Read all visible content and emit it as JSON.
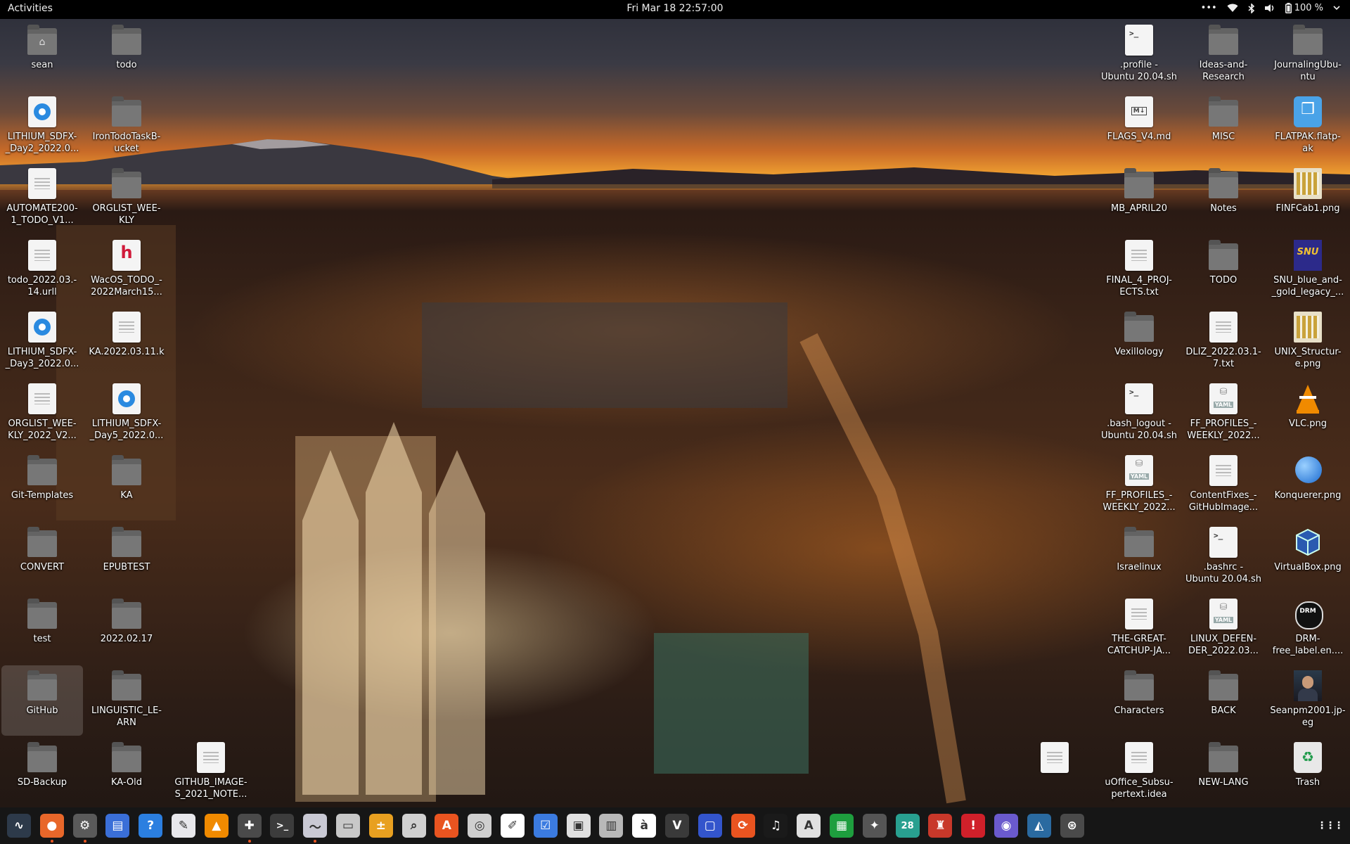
{
  "topbar": {
    "activities": "Activities",
    "clock": "Fri Mar 18  22:57:00",
    "overflow": "•••",
    "battery": "100 %"
  },
  "desktop": [
    {
      "label": "sean",
      "icon": "home-folder-icon",
      "type": "home"
    },
    {
      "label": "todo",
      "icon": "folder-icon",
      "type": "folder"
    },
    {
      "label": ".profile -\nUbuntu 20.04.sh",
      "icon": "terminal-script-icon",
      "type": "script"
    },
    {
      "label": "Ideas-and-\nResearch",
      "icon": "folder-icon",
      "type": "folder"
    },
    {
      "label": "JournalingUbu-\nntu",
      "icon": "folder-icon",
      "type": "folder"
    },
    {
      "label": "LITHIUM_SDFX-\n_Day2_2022.0...",
      "icon": "lithium-doc-icon",
      "type": "lithium"
    },
    {
      "label": "IronTodoTaskB-\nucket",
      "icon": "folder-icon",
      "type": "folder"
    },
    {
      "label": "FLAGS_V4.md",
      "icon": "markdown-icon",
      "type": "md"
    },
    {
      "label": "MISC",
      "icon": "folder-icon",
      "type": "folder"
    },
    {
      "label": "FLATPAK.flatp-\nak",
      "icon": "flatpak-icon",
      "type": "flatpak"
    },
    {
      "label": "AUTOMATE200-\n1_TODO_V1...",
      "icon": "text-file-icon",
      "type": "doc"
    },
    {
      "label": "ORGLIST_WEE-\nKLY",
      "icon": "folder-icon",
      "type": "folder"
    },
    {
      "label": "MB_APRIL20",
      "icon": "folder-icon",
      "type": "folder"
    },
    {
      "label": "Notes",
      "icon": "folder-icon",
      "type": "folder"
    },
    {
      "label": "FINFCab1.png",
      "icon": "image-icon",
      "type": "img"
    },
    {
      "label": "todo_2022.03.-\n14.urll",
      "icon": "text-file-icon",
      "type": "doc"
    },
    {
      "label": "WacOS_TODO_-\n2022March15...",
      "icon": "hackmd-icon",
      "type": "hmd"
    },
    {
      "label": "FINAL_4_PROJ-\nECTS.txt",
      "icon": "text-file-icon",
      "type": "doc"
    },
    {
      "label": "TODO",
      "icon": "folder-icon",
      "type": "folder"
    },
    {
      "label": "SNU_blue_and-\n_gold_legacy_...",
      "icon": "snu-image-icon",
      "type": "snu"
    },
    {
      "label": "LITHIUM_SDFX-\n_Day3_2022.0...",
      "icon": "lithium-doc-icon",
      "type": "lithium"
    },
    {
      "label": "KA.2022.03.11.k",
      "icon": "text-file-icon",
      "type": "doc"
    },
    {
      "label": "Vexillology",
      "icon": "folder-icon",
      "type": "folder"
    },
    {
      "label": "DLIZ_2022.03.1-\n7.txt",
      "icon": "text-file-icon",
      "type": "doc"
    },
    {
      "label": "UNIX_Structur-\ne.png",
      "icon": "image-icon",
      "type": "img"
    },
    {
      "label": "ORGLIST_WEE-\nKLY_2022_V2...",
      "icon": "text-file-icon",
      "type": "doc"
    },
    {
      "label": "LITHIUM_SDFX-\n_Day5_2022.0...",
      "icon": "lithium-doc-icon",
      "type": "lithium"
    },
    {
      "label": ".bash_logout -\nUbuntu 20.04.sh",
      "icon": "terminal-script-icon",
      "type": "script"
    },
    {
      "label": "FF_PROFILES_-\nWEEKLY_2022...",
      "icon": "yaml-icon",
      "type": "yaml"
    },
    {
      "label": "VLC.png",
      "icon": "vlc-icon",
      "type": "vlc"
    },
    {
      "label": "Git-Templates",
      "icon": "folder-icon",
      "type": "folder"
    },
    {
      "label": "KA",
      "icon": "folder-icon",
      "type": "folder"
    },
    {
      "label": "FF_PROFILES_-\nWEEKLY_2022...",
      "icon": "yaml-icon",
      "type": "yaml"
    },
    {
      "label": "ContentFixes_-\nGitHubImage...",
      "icon": "text-file-icon",
      "type": "doc"
    },
    {
      "label": "Konquerer.png",
      "icon": "konqueror-icon",
      "type": "globe"
    },
    {
      "label": "CONVERT",
      "icon": "folder-icon",
      "type": "folder"
    },
    {
      "label": "EPUBTEST",
      "icon": "folder-icon",
      "type": "folder"
    },
    {
      "label": "Israelinux",
      "icon": "folder-icon",
      "type": "folder"
    },
    {
      "label": ".bashrc -\nUbuntu 20.04.sh",
      "icon": "terminal-script-icon",
      "type": "script"
    },
    {
      "label": "VirtualBox.png",
      "icon": "virtualbox-icon",
      "type": "vbox"
    },
    {
      "label": "test",
      "icon": "folder-icon",
      "type": "folder"
    },
    {
      "label": "2022.02.17",
      "icon": "folder-icon",
      "type": "folder"
    },
    {
      "label": "THE-GREAT-\nCATCHUP-JA...",
      "icon": "text-file-icon",
      "type": "doc"
    },
    {
      "label": "LINUX_DEFEN-\nDER_2022.03...",
      "icon": "yaml-icon",
      "type": "yaml"
    },
    {
      "label": "DRM-\nfree_label.en....",
      "icon": "drm-free-icon",
      "type": "drm"
    },
    {
      "label": "GitHub",
      "icon": "folder-icon",
      "type": "folder"
    },
    {
      "label": "LINGUISTIC_LE-\nARN",
      "icon": "folder-icon",
      "type": "folder"
    },
    {
      "label": "Characters",
      "icon": "folder-icon",
      "type": "folder"
    },
    {
      "label": "BACK",
      "icon": "folder-icon",
      "type": "folder"
    },
    {
      "label": "Seanpm2001.jp-\neg",
      "icon": "photo-icon",
      "type": "photo"
    },
    {
      "label": "SD-Backup",
      "icon": "folder-icon",
      "type": "folder"
    },
    {
      "label": "KA-Old",
      "icon": "folder-icon",
      "type": "folder"
    },
    {
      "label": "GITHUB_IMAGE-\nS_2021_NOTE...",
      "icon": "text-file-icon",
      "type": "doc"
    },
    {
      "label": "",
      "icon": "text-file-icon",
      "type": "doc"
    },
    {
      "label": "uOffice_Subsu-\npertext.idea",
      "icon": "text-file-icon",
      "type": "doc"
    },
    {
      "label": "NEW-LANG",
      "icon": "folder-icon",
      "type": "folder"
    },
    {
      "label": "Trash",
      "icon": "trash-icon",
      "type": "trash"
    }
  ],
  "dock": [
    {
      "name": "system-monitor-icon",
      "glyph": "∿",
      "bg": "#2d3a4a",
      "running": false
    },
    {
      "name": "firefox-icon",
      "glyph": "●",
      "bg": "#e8672a",
      "running": true
    },
    {
      "name": "settings-icon",
      "glyph": "⚙",
      "bg": "#5a5a5a",
      "running": true
    },
    {
      "name": "document-viewer-icon",
      "glyph": "▤",
      "bg": "#3a6fd8",
      "running": false
    },
    {
      "name": "help-icon",
      "glyph": "?",
      "bg": "#2b7fe0",
      "running": false
    },
    {
      "name": "text-editor-icon",
      "glyph": "✎",
      "bg": "#e8e8ec",
      "running": false
    },
    {
      "name": "vlc-icon",
      "glyph": "▲",
      "bg": "#f08a00",
      "running": false
    },
    {
      "name": "extensions-icon",
      "glyph": "✚",
      "bg": "#4a4a4a",
      "running": true
    },
    {
      "name": "terminal-icon",
      "glyph": ">_",
      "bg": "#3c3c3c",
      "running": false
    },
    {
      "name": "resource-monitor-icon",
      "glyph": "〜",
      "bg": "#c9c9d4",
      "running": true
    },
    {
      "name": "files-icon",
      "glyph": "▭",
      "bg": "#c8c8c8",
      "running": false
    },
    {
      "name": "calculator-icon",
      "glyph": "±",
      "bg": "#e8a020",
      "running": false
    },
    {
      "name": "image-viewer-icon",
      "glyph": "⌕",
      "bg": "#d0d0d0",
      "running": false
    },
    {
      "name": "software-center-icon",
      "glyph": "A",
      "bg": "#e95420",
      "running": false
    },
    {
      "name": "disc-icon",
      "glyph": "◎",
      "bg": "#cfcfcf",
      "running": false
    },
    {
      "name": "libreoffice-draw-icon",
      "glyph": "✐",
      "bg": "#ffffff",
      "running": false
    },
    {
      "name": "todo-icon",
      "glyph": "☑",
      "bg": "#3b7be0",
      "running": false
    },
    {
      "name": "screenshot-icon",
      "glyph": "▣",
      "bg": "#e0e0e0",
      "running": false
    },
    {
      "name": "archive-icon",
      "glyph": "▥",
      "bg": "#b8b8b8",
      "running": false
    },
    {
      "name": "font-viewer-icon",
      "glyph": "à",
      "bg": "#ffffff",
      "running": false
    },
    {
      "name": "vim-icon",
      "glyph": "V",
      "bg": "#3a3a3a",
      "running": false
    },
    {
      "name": "remote-desktop-icon",
      "glyph": "▢",
      "bg": "#3355cc",
      "running": false
    },
    {
      "name": "update-manager-icon",
      "glyph": "⟳",
      "bg": "#e95420",
      "running": false
    },
    {
      "name": "music-icon",
      "glyph": "♫",
      "bg": "#1a1a1a",
      "running": false
    },
    {
      "name": "font-manager-icon",
      "glyph": "A",
      "bg": "#e0e0e0",
      "running": false
    },
    {
      "name": "spreadsheet-icon",
      "glyph": "▦",
      "bg": "#1e9e3e",
      "running": false
    },
    {
      "name": "wireless-tool-icon",
      "glyph": "✦",
      "bg": "#555555",
      "running": false
    },
    {
      "name": "calendar-icon",
      "glyph": "28",
      "bg": "#28a090",
      "running": false
    },
    {
      "name": "game-icon",
      "glyph": "♜",
      "bg": "#c8382a",
      "running": false
    },
    {
      "name": "alert-icon",
      "glyph": "!",
      "bg": "#d0202a",
      "running": false
    },
    {
      "name": "screen-recorder-icon",
      "glyph": "◉",
      "bg": "#6a5acd",
      "running": false
    },
    {
      "name": "map-icon",
      "glyph": "◭",
      "bg": "#2a6aa0",
      "running": false
    },
    {
      "name": "app-center-icon",
      "glyph": "⊛",
      "bg": "#4a4a4a",
      "running": false
    }
  ],
  "dock_grid_glyph": "⋮⋮⋮"
}
